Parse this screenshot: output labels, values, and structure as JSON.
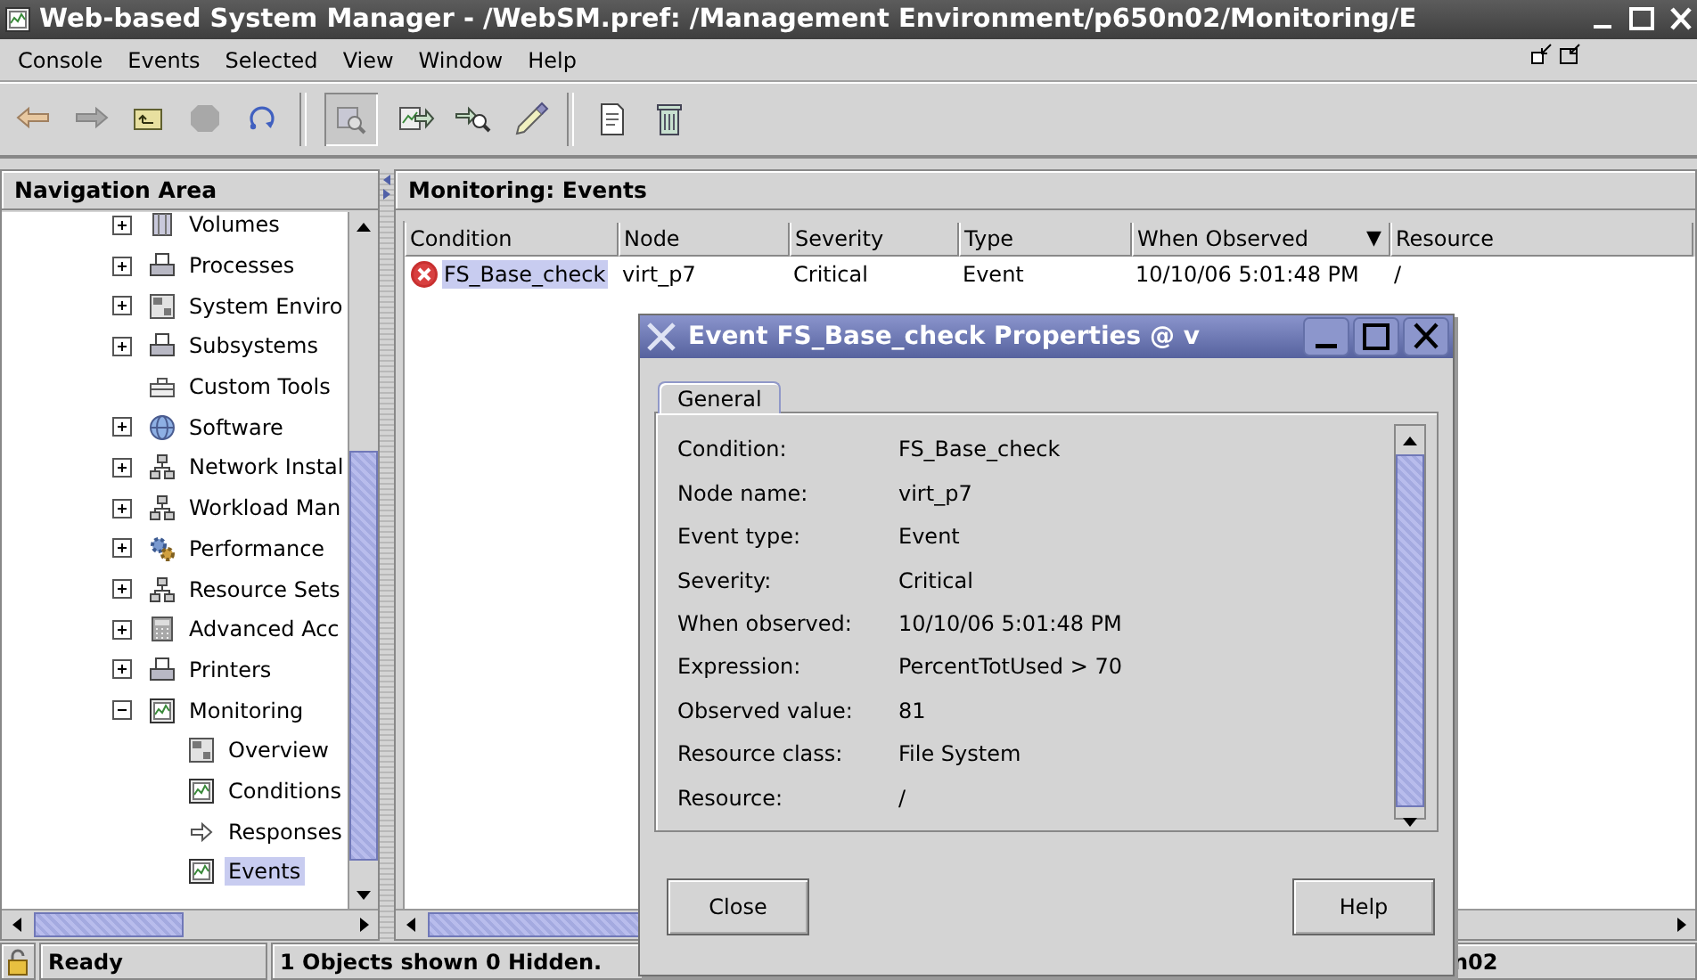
{
  "window": {
    "title": "Web-based System Manager - /WebSM.pref: /Management Environment/p650n02/Monitoring/E"
  },
  "menu": [
    "Console",
    "Events",
    "Selected",
    "View",
    "Window",
    "Help"
  ],
  "navigation": {
    "title": "Navigation Area",
    "items": [
      {
        "label": "Volumes",
        "expanded": false,
        "selected": false
      },
      {
        "label": "Processes",
        "expanded": false,
        "selected": false
      },
      {
        "label": "System Enviro",
        "expanded": false,
        "selected": false
      },
      {
        "label": "Subsystems",
        "expanded": false,
        "selected": false
      },
      {
        "label": "Custom Tools",
        "selected": false
      },
      {
        "label": "Software",
        "expanded": false,
        "selected": false
      },
      {
        "label": "Network Instal",
        "expanded": false,
        "selected": false
      },
      {
        "label": "Workload Man",
        "expanded": false,
        "selected": false
      },
      {
        "label": "Performance",
        "expanded": false,
        "selected": false
      },
      {
        "label": "Resource Sets",
        "expanded": false,
        "selected": false
      },
      {
        "label": "Advanced Acc",
        "expanded": false,
        "selected": false
      },
      {
        "label": "Printers",
        "expanded": false,
        "selected": false
      },
      {
        "label": "Monitoring",
        "expanded": true,
        "selected": false,
        "children": [
          {
            "label": "Overview",
            "selected": false
          },
          {
            "label": "Conditions",
            "selected": false
          },
          {
            "label": "Responses",
            "selected": false
          },
          {
            "label": "Events",
            "selected": true
          }
        ]
      }
    ]
  },
  "content": {
    "title": "Monitoring: Events",
    "table": {
      "columns": [
        {
          "label": "Condition"
        },
        {
          "label": "Node"
        },
        {
          "label": "Severity"
        },
        {
          "label": "Type"
        },
        {
          "label": "When Observed",
          "sort_indicator": "▼"
        },
        {
          "label": "Resource"
        }
      ],
      "rows": [
        {
          "selected": true,
          "kind": "critical",
          "cells": [
            "FS_Base_check",
            "virt_p7",
            "Critical",
            "Event",
            "10/10/06 5:01:48 PM",
            "/"
          ]
        }
      ]
    }
  },
  "dialog": {
    "title": "Event FS_Base_check Properties @ v",
    "tabs": [
      {
        "label": "General",
        "selected": true
      }
    ],
    "properties": [
      {
        "label": "Condition:",
        "value": "FS_Base_check"
      },
      {
        "label": "Node name:",
        "value": "virt_p7"
      },
      {
        "label": "Event type:",
        "value": "Event"
      },
      {
        "label": "Severity:",
        "value": "Critical"
      },
      {
        "label": "When observed:",
        "value": "10/10/06 5:01:48 PM"
      },
      {
        "label": "Expression:",
        "value": "PercentTotUsed > 70"
      },
      {
        "label": "Observed value:",
        "value": "81"
      },
      {
        "label": "Resource class:",
        "value": "File System"
      },
      {
        "label": "Resource:",
        "value": "/"
      }
    ],
    "buttons": [
      "Close",
      "Help"
    ]
  },
  "status_bar": {
    "cells": [
      "Ready",
      "1 Objects shown 0 Hidden.",
      "n02"
    ]
  }
}
